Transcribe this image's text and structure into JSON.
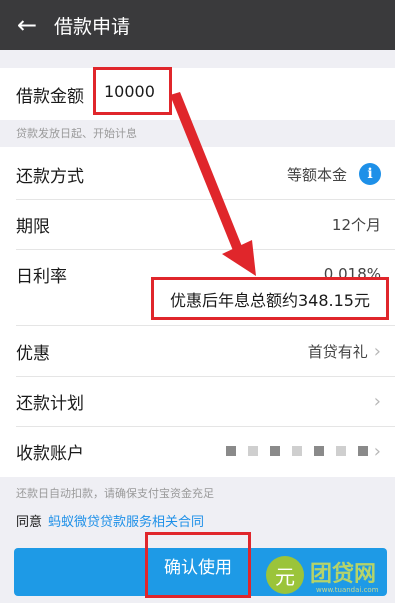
{
  "header": {
    "title": "借款申请",
    "back_icon": "arrow-left-icon"
  },
  "loan": {
    "amount_label": "借款金额",
    "amount_value": "10000",
    "hint": "贷款发放日起、开始计息"
  },
  "details": {
    "repay_method_label": "还款方式",
    "repay_method_value": "等额本金",
    "info_icon": "i",
    "term_label": "期限",
    "term_value": "12个月",
    "rate_label": "日利率",
    "rate_value": "0.018%",
    "promo_interest": "优惠后年息总额约348.15元",
    "discount_label": "优惠",
    "discount_value": "首贷有礼",
    "plan_label": "还款计划",
    "account_label": "收款账户"
  },
  "footer": {
    "auto_debit_hint": "还款日自动扣款，请确保支付宝资金充足",
    "agree_prefix": "同意",
    "agree_link": "蚂蚁微贷贷款服务相关合同",
    "confirm_label": "确认使用"
  },
  "watermark": {
    "mark": "元",
    "text": "团贷网",
    "sub": "www.tuandai.com"
  },
  "colors": {
    "header_bg": "#3a3a3c",
    "accent": "#1e90e8",
    "highlight": "#e0262b",
    "button": "#1e9ae6"
  }
}
